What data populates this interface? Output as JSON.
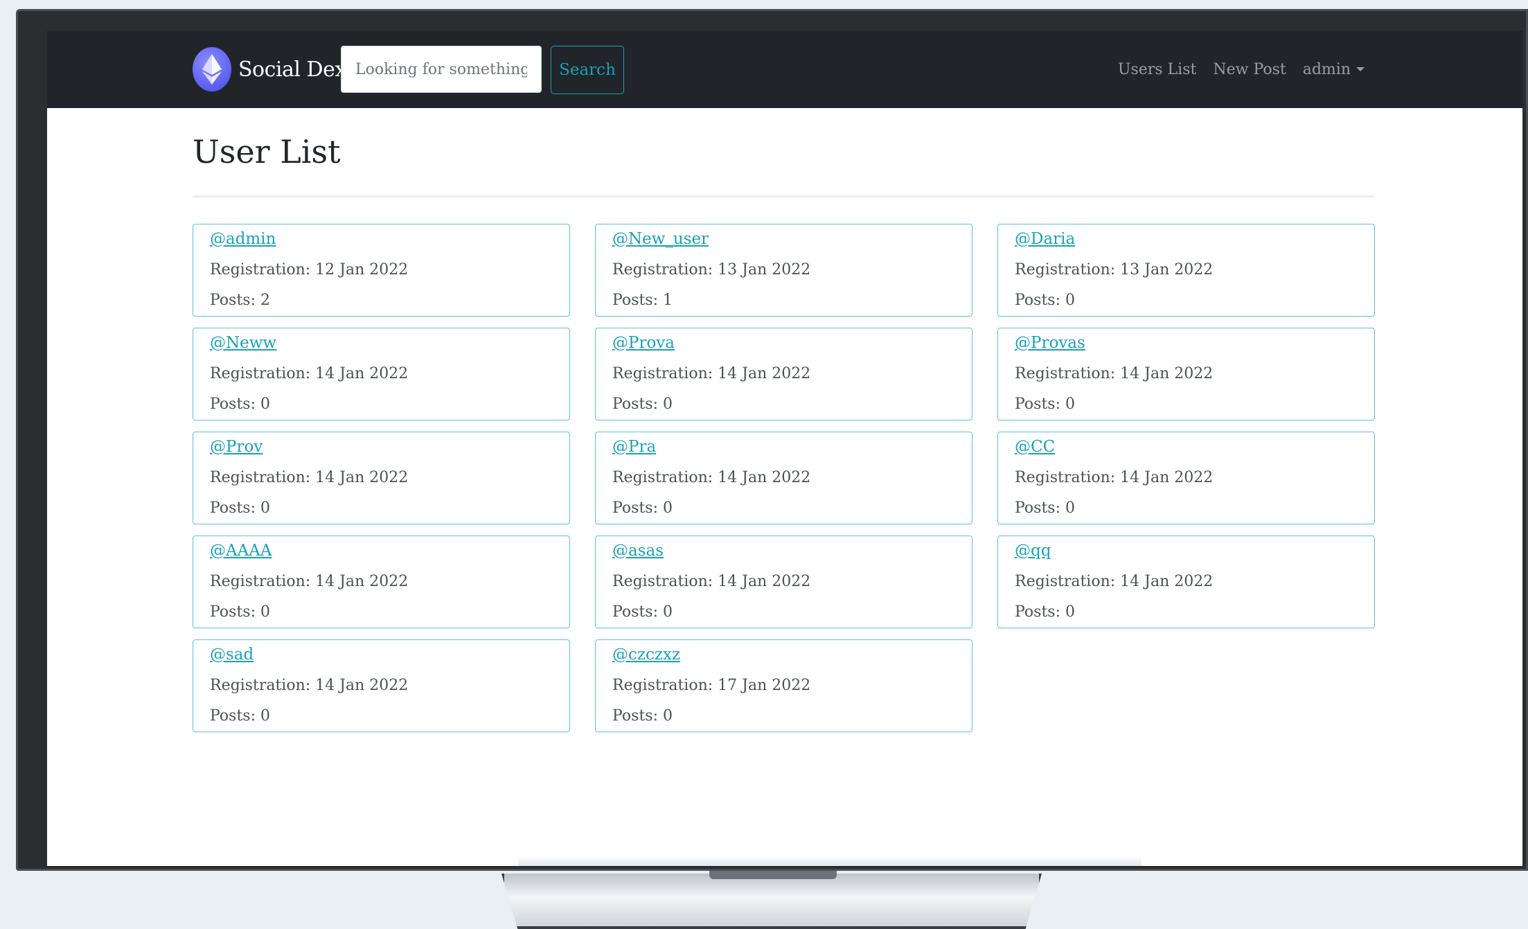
{
  "navbar": {
    "brand_name": "Social Dex",
    "search_placeholder": "Looking for something?",
    "search_label": "Search",
    "links": {
      "users_list": "Users List",
      "new_post": "New Post",
      "account": "admin"
    }
  },
  "main": {
    "title": "User List",
    "users": [
      {
        "handle": "@admin",
        "registration": "Registration: 12 Jan 2022",
        "posts": "Posts: 2"
      },
      {
        "handle": "@New_user",
        "registration": "Registration: 13 Jan 2022",
        "posts": "Posts: 1"
      },
      {
        "handle": "@Daria",
        "registration": "Registration: 13 Jan 2022",
        "posts": "Posts: 0"
      },
      {
        "handle": "@Neww",
        "registration": "Registration: 14 Jan 2022",
        "posts": "Posts: 0"
      },
      {
        "handle": "@Prova",
        "registration": "Registration: 14 Jan 2022",
        "posts": "Posts: 0"
      },
      {
        "handle": "@Provas",
        "registration": "Registration: 14 Jan 2022",
        "posts": "Posts: 0"
      },
      {
        "handle": "@Prov",
        "registration": "Registration: 14 Jan 2022",
        "posts": "Posts: 0"
      },
      {
        "handle": "@Pra",
        "registration": "Registration: 14 Jan 2022",
        "posts": "Posts: 0"
      },
      {
        "handle": "@CC",
        "registration": "Registration: 14 Jan 2022",
        "posts": "Posts: 0"
      },
      {
        "handle": "@AAAA",
        "registration": "Registration: 14 Jan 2022",
        "posts": "Posts: 0"
      },
      {
        "handle": "@asas",
        "registration": "Registration: 14 Jan 2022",
        "posts": "Posts: 0"
      },
      {
        "handle": "@qq",
        "registration": "Registration: 14 Jan 2022",
        "posts": "Posts: 0"
      },
      {
        "handle": "@sad",
        "registration": "Registration: 14 Jan 2022",
        "posts": "Posts: 0"
      },
      {
        "handle": "@czczxz",
        "registration": "Registration: 17 Jan 2022",
        "posts": "Posts: 0"
      }
    ]
  },
  "colors": {
    "navbar_bg": "#212529",
    "accent": "#17a2b8",
    "card_border": "#5bc0de",
    "brand_logo": "#5b5ef0"
  },
  "icons": {
    "brand_logo": "ethereum-icon",
    "account_menu": "caret-down-icon"
  }
}
